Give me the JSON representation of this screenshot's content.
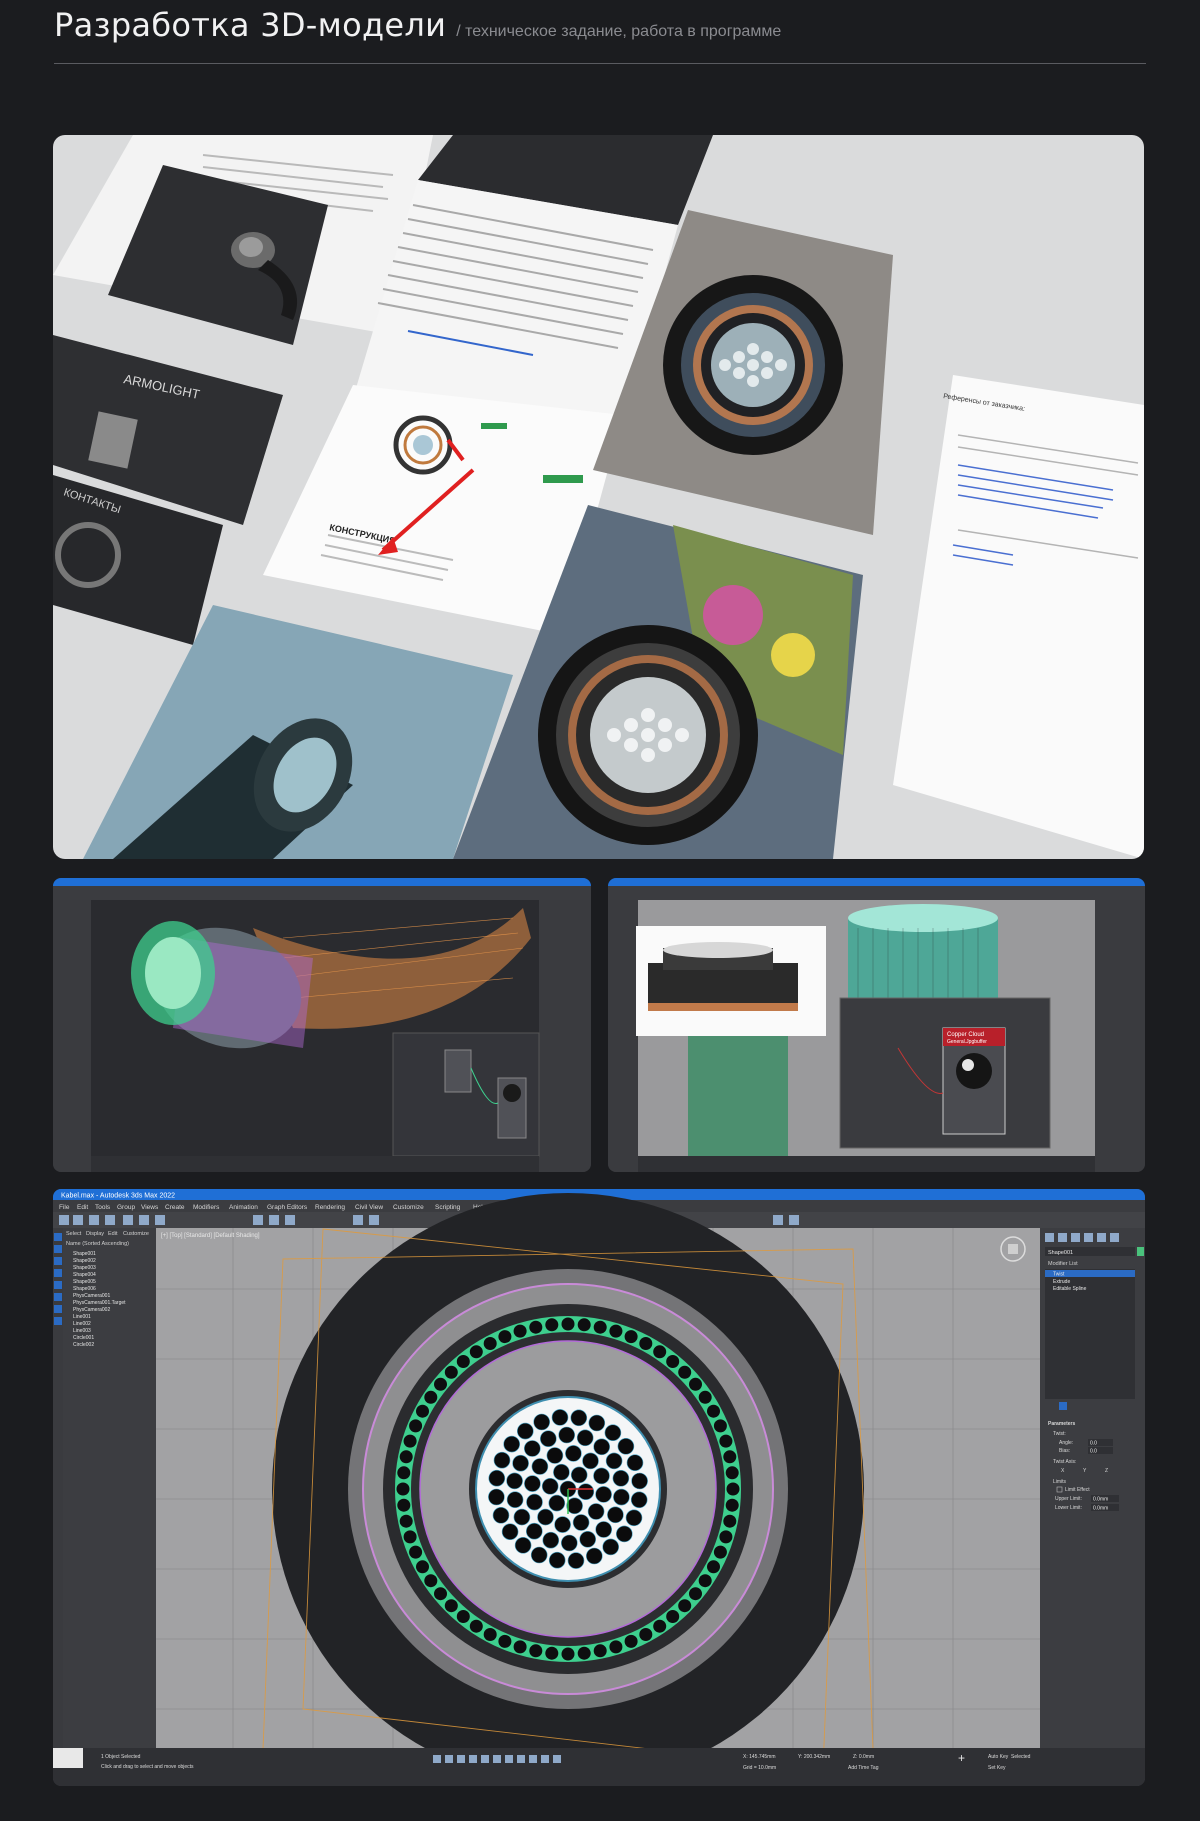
{
  "header": {
    "title": "Разработка 3D-модели",
    "subtitle": "/ техническое задание, работа в программе"
  },
  "collage": {
    "doc_brand": "ARMOLIGHT",
    "doc_section": "КОНСТРУКЦИЯ",
    "doc_contacts": "КОНТАКТЫ",
    "refs_heading": "Референсы от заказчика:"
  },
  "max_window": {
    "title": "Kabel.max - Autodesk 3ds Max 2022",
    "menu": [
      "File",
      "Edit",
      "Tools",
      "Group",
      "Views",
      "Create",
      "Modifiers",
      "Animation",
      "Graph Editors",
      "Rendering",
      "Civil View",
      "Customize",
      "Scripting",
      "Help"
    ],
    "scene_panel": {
      "tabs": [
        "Select",
        "Display",
        "Edit",
        "Customize"
      ],
      "sort": "Name (Sorted Ascending)"
    },
    "scene_items": [
      "Shape001",
      "Shape002",
      "Shape003",
      "Shape004",
      "Shape005",
      "Shape006",
      "PhysCamera001",
      "PhysCamera001.Target",
      "PhysCamera002",
      "Line001",
      "Line002",
      "Line003",
      "Circle001",
      "Circle002"
    ],
    "viewport_label": "[+] [Top] [Standard] [Default Shading]",
    "right_panel": {
      "object_name": "Shape001",
      "modifier_list": "Modifier List",
      "stack": [
        "Twist",
        "Extrude",
        "Editable Spline"
      ],
      "params_title": "Parameters",
      "twist": "Twist:",
      "angle_label": "Angle:",
      "angle_value": "0.0",
      "bias_label": "Bias:",
      "bias_value": "0.0",
      "axis_label": "Twist Axis:",
      "axes": [
        "X",
        "Y",
        "Z"
      ],
      "limits": "Limits",
      "limit_effect": "Limit Effect",
      "upper": "Upper Limit:",
      "lower": "Lower Limit:",
      "limit_value": "0.0mm"
    },
    "status": {
      "selected": "1 Object Selected",
      "hint": "Click and drag to select and move objects",
      "x": "X: 145.745mm",
      "y": "Y: 200.342mm",
      "z": "Z: 0.0mm",
      "grid": "Grid = 10.0mm",
      "autokey": "Auto Key",
      "selected_mode": "Selected",
      "setkey": "Set Key",
      "addtime": "Add Time Tag"
    },
    "material_popup": {
      "title": "Copper Cloud",
      "subtitle": "General.Jpgbuffer"
    }
  },
  "colors": {
    "accent": "#1f6fd6",
    "wire_green": "#3ecf8e",
    "wire_orange": "#f09b4c",
    "wire_purple": "#b26ad8"
  }
}
